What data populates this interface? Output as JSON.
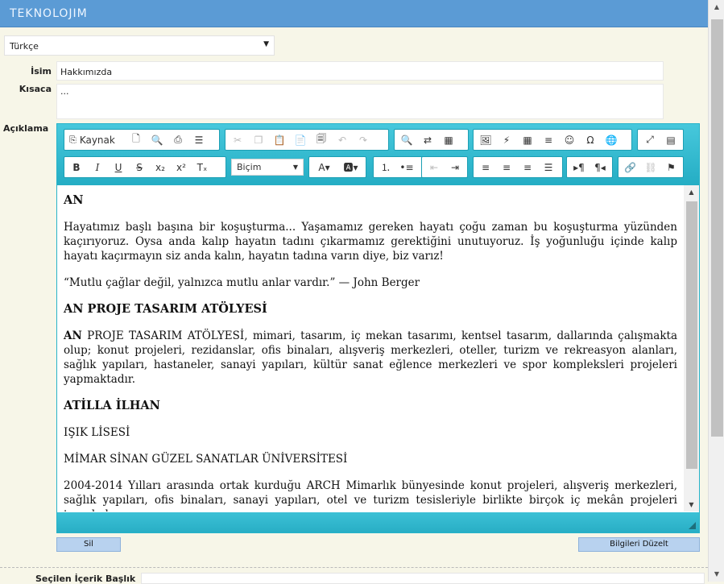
{
  "app": {
    "brand": "TEKNOLOJIM"
  },
  "language_select": {
    "value": "Türkçe"
  },
  "form": {
    "name_label": "İsim",
    "name_value": "Hakkımızda",
    "short_label": "Kısaca",
    "short_value": "...",
    "desc_label": "Açıklama"
  },
  "toolbar": {
    "source_label": "Kaynak",
    "format_label": "Biçim"
  },
  "content": {
    "h1": "AN",
    "p1": "Hayatımız başlı başına bir koşuşturma... Yaşamamız gereken hayatı çoğu zaman bu koşuşturma yüzünden kaçırıyoruz. Oysa anda kalıp hayatın tadını çıkarmamız gerektiğini unutuyoruz. İş yoğunluğu içinde kalıp hayatı kaçırmayın siz anda kalın, hayatın tadına varın diye, biz varız!",
    "quote": "“Mutlu çağlar değil, yalnızca mutlu anlar vardır.”  — John Berger",
    "h2": "AN PROJE TASARIM ATÖLYESİ",
    "p2_bold": "AN",
    "p2_rest": " PROJE TASARIM ATÖLYESİ, mimari, tasarım, iç mekan tasarımı, kentsel tasarım, dallarında çalışmakta olup; konut projeleri, rezidanslar, ofis binaları, alışveriş merkezleri, oteller, turizm ve rekreasyon alanları, sağlık yapıları, hastaneler, sanayi yapıları, kültür sanat eğlence merkezleri ve spor kompleksleri projeleri yapmaktadır.",
    "h3": "ATİLLA İLHAN",
    "p3": "IŞIK LİSESİ",
    "p4": "MİMAR SİNAN GÜZEL SANATLAR ÜNİVERSİTESİ",
    "p5": "2004-2014 Yılları arasında ortak kurduğu ARCH Mimarlık bünyesinde konut projeleri, alışveriş merkezleri, sağlık yapıları, ofis binaları, sanayi yapıları, otel ve turizm tesisleriyle birlikte birçok iç mekân projeleri tasarladı."
  },
  "buttons": {
    "delete": "Sil",
    "update": "Bilgileri Düzelt"
  },
  "bottom": {
    "label": "Seçilen İçerik Başlık"
  }
}
